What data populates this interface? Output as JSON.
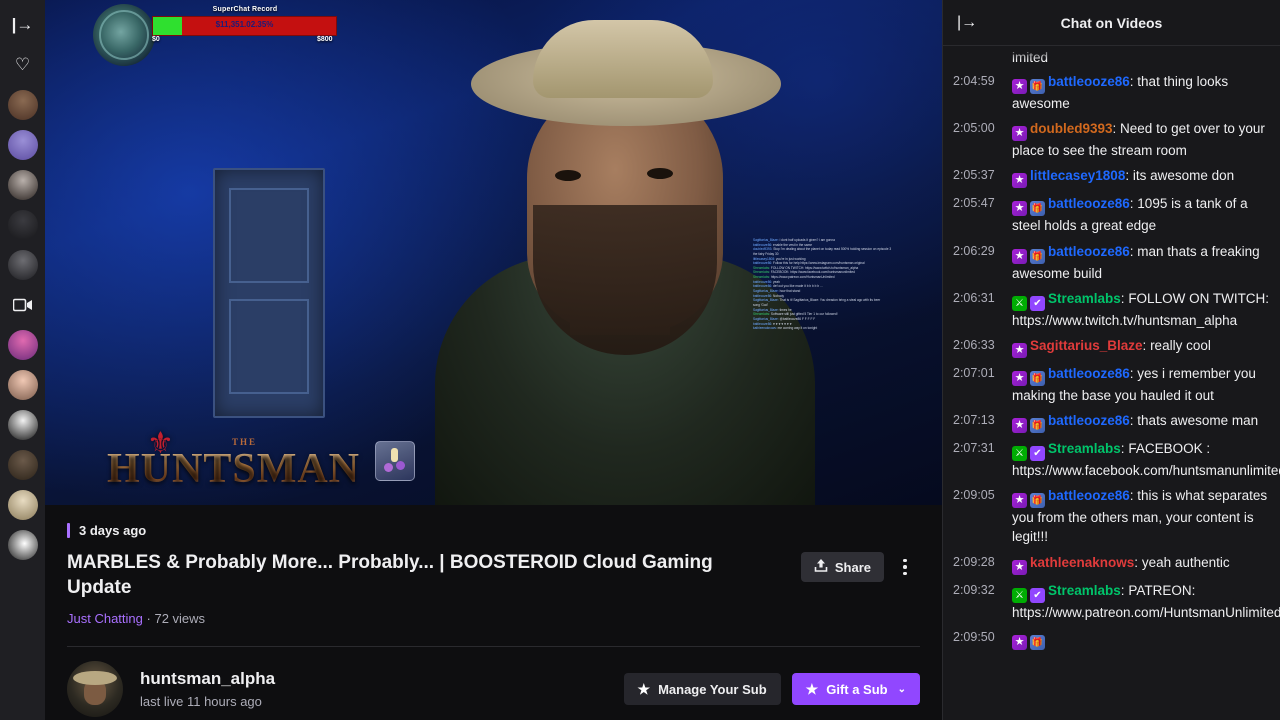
{
  "rail": {
    "collapse_icon": "|→",
    "items": [
      {
        "name": "collapse-sidebar",
        "type": "icon",
        "glyph": "|→"
      },
      {
        "name": "followed-heart",
        "type": "icon",
        "glyph": "♡"
      },
      {
        "name": "channel-avatar-1",
        "type": "avatar",
        "color1": "#8a6a52",
        "color2": "#4a3024"
      },
      {
        "name": "channel-avatar-2",
        "type": "avatar",
        "color1": "#9a8fd6",
        "color2": "#5b4ba0"
      },
      {
        "name": "channel-avatar-3",
        "type": "avatar",
        "color1": "#b9b0ab",
        "color2": "#2a2320"
      },
      {
        "name": "channel-avatar-4",
        "type": "avatar",
        "color1": "#3b3b40",
        "color2": "#17171a"
      },
      {
        "name": "channel-avatar-5",
        "type": "avatar",
        "color1": "#6d6d72",
        "color2": "#1c1c20"
      },
      {
        "name": "video-camera",
        "type": "icon",
        "glyph": "▢"
      },
      {
        "name": "channel-avatar-6",
        "type": "avatar",
        "color1": "#e06ab0",
        "color2": "#6a2a7a"
      },
      {
        "name": "channel-avatar-7",
        "type": "avatar",
        "color1": "#f0c8b4",
        "color2": "#7a5a4a"
      },
      {
        "name": "channel-avatar-8",
        "type": "avatar",
        "color1": "#f2f2f2",
        "color2": "#121212"
      },
      {
        "name": "channel-avatar-9",
        "type": "avatar",
        "color1": "#6b5a4a",
        "color2": "#2b2218"
      },
      {
        "name": "channel-avatar-10",
        "type": "avatar",
        "color1": "#e8dcc2",
        "color2": "#8a7a58"
      },
      {
        "name": "channel-avatar-11",
        "type": "avatar",
        "color1": "#ffffff",
        "color2": "#141414"
      }
    ]
  },
  "player": {
    "donation_overlay": {
      "title": "SuperChat Record",
      "amount": "$11,351.02.35%",
      "min_label": "$0",
      "max_label": "$800",
      "fill_percent": 16,
      "bar_color": "#c41010",
      "fill_color": "#2fe02f"
    },
    "branding": {
      "the_label": "THE",
      "name": "HUNTSMAN"
    },
    "chat_overlay_lines": [
      "Sagittarius_Blaze: i dont half uploads it given? i am gonna",
      "battleooze86: enable the vest in the same",
      "doubled9393: Stop I'm dealing about the planet on today read 500% holding session on episode 3",
      "  the fairy Friday 30",
      "littlecasey1808: you're in just working",
      "battleooze86: Follow this for help https://www.instagram.com/huntsman.original",
      "Streamlabs: FOLLOW ON TWITCH: https://www.twitch.tv/huntsman_alpha",
      "Streamlabs: FACEBOOK: https://www.facebook.com/huntsmanunlimited",
      "Streamlabs: https://www.patreon.com/HuntsmanUnlimited",
      "battleooze86: yeah",
      "battleooze86: def out you like made it  b  b  b  b  b ...",
      "Sagittarius_Blaze: how that stand",
      "battleooze86: Nobody",
      "Sagittarius_Blaze: That is it! Sagittarius_Blaze: You dreadon bring a steal ago with its beer",
      "  song 'God'",
      "Sagittarius_Blaze: times he",
      "Streamlabs: Software still just gifted 5 Tier 1 to our followed!",
      "Sagittarius_Blaze: @battleooze86 F F F F F",
      "battleooze86: ♥ ♥ ♥ ♥ ♥ ♥ ♥",
      "kathleenaknows: me coming way it on tonight"
    ]
  },
  "video_meta": {
    "uploaded_ago": "3 days ago",
    "title": "MARBLES & Probably More... Probably... | BOOSTEROID Cloud Gaming Update",
    "category": "Just Chatting",
    "views": "72 views",
    "separator": "·",
    "share_label": "Share",
    "share_icon": "share-upload-icon",
    "more_icon": "kebab-menu-icon"
  },
  "channel": {
    "name": "huntsman_alpha",
    "last_live": "last live 11 hours ago",
    "manage_sub_label": "Manage Your Sub",
    "gift_sub_label": "Gift a Sub",
    "gift_chevron": "⌄",
    "star_glyph": "★",
    "accent_color": "#9147ff"
  },
  "chat": {
    "collapse_icon": "|→",
    "title": "Chat on Videos",
    "partial_top_line": "imited",
    "messages": [
      {
        "time": "2:04:59",
        "badges": [
          "sub",
          "gift"
        ],
        "user": "battleooze86",
        "user_color": "#1f69ff",
        "text": "that thing looks awesome"
      },
      {
        "time": "2:05:00",
        "badges": [
          "sub"
        ],
        "user": "doubled9393",
        "user_color": "#d2691e",
        "text": "Need to get over to your place to see the stream room"
      },
      {
        "time": "2:05:37",
        "badges": [
          "sub"
        ],
        "user": "littlecasey1808",
        "user_color": "#1f69ff",
        "text": "its awesome don"
      },
      {
        "time": "2:05:47",
        "badges": [
          "sub",
          "gift"
        ],
        "user": "battleooze86",
        "user_color": "#1f69ff",
        "text": "1095 is a tank of a steel holds a great edge"
      },
      {
        "time": "2:06:29",
        "badges": [
          "sub",
          "gift"
        ],
        "user": "battleooze86",
        "user_color": "#1f69ff",
        "text": "man thats a freaking awesome build"
      },
      {
        "time": "2:06:31",
        "badges": [
          "mod",
          "verified"
        ],
        "user": "Streamlabs",
        "user_color": "#00c46a",
        "text": "FOLLOW ON TWITCH: https://www.twitch.tv/huntsman_alpha"
      },
      {
        "time": "2:06:33",
        "badges": [
          "sub"
        ],
        "user": "Sagittarius_Blaze",
        "user_color": "#e03b3b",
        "text": "really cool"
      },
      {
        "time": "2:07:01",
        "badges": [
          "sub",
          "gift"
        ],
        "user": "battleooze86",
        "user_color": "#1f69ff",
        "text": "yes i remember you making the base you hauled it out"
      },
      {
        "time": "2:07:13",
        "badges": [
          "sub",
          "gift"
        ],
        "user": "battleooze86",
        "user_color": "#1f69ff",
        "text": "thats awesome man"
      },
      {
        "time": "2:07:31",
        "badges": [
          "mod",
          "verified"
        ],
        "user": "Streamlabs",
        "user_color": "#00c46a",
        "text": "FACEBOOK : https://www.facebook.com/huntsmanunlimited"
      },
      {
        "time": "2:09:05",
        "badges": [
          "sub",
          "gift"
        ],
        "user": "battleooze86",
        "user_color": "#1f69ff",
        "text": "this is what separates you from the others man, your content is legit!!!"
      },
      {
        "time": "2:09:28",
        "badges": [
          "sub"
        ],
        "user": "kathleenaknows",
        "user_color": "#e03b3b",
        "text": "yeah authentic"
      },
      {
        "time": "2:09:32",
        "badges": [
          "mod",
          "verified"
        ],
        "user": "Streamlabs",
        "user_color": "#00c46a",
        "text": "PATREON: https://www.patreon.com/HuntsmanUnlimited"
      },
      {
        "time": "2:09:50",
        "badges": [
          "sub",
          "gift"
        ],
        "user": "",
        "user_color": "#1f69ff",
        "text": ""
      }
    ],
    "badge_glyphs": {
      "sub": "★",
      "gift": "🎁",
      "mod": "⚔",
      "verified": "✔"
    }
  }
}
